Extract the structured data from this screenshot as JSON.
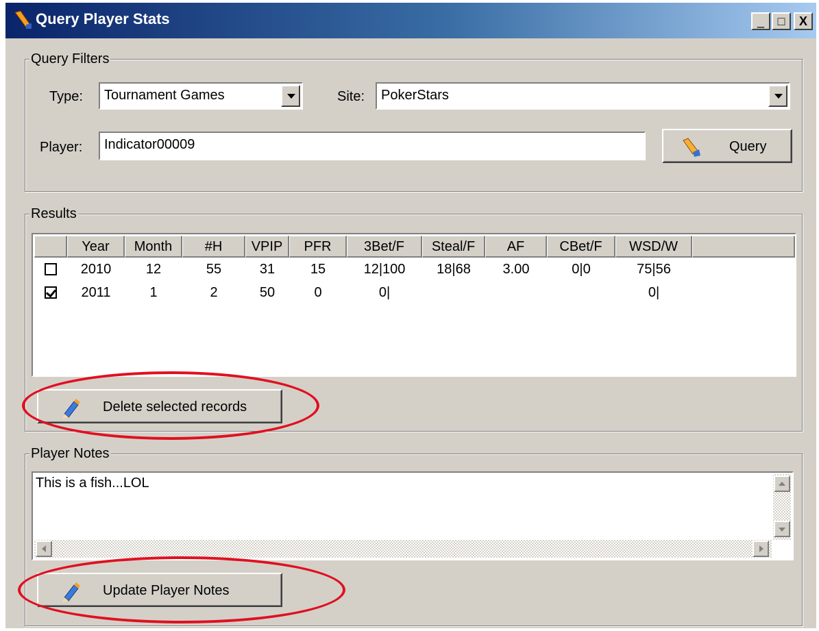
{
  "window": {
    "title": "Query Player Stats",
    "controls": [
      "_",
      "□",
      "X"
    ]
  },
  "filters": {
    "legend": "Query Filters",
    "type_label": "Type:",
    "type_value": "Tournament Games",
    "site_label": "Site:",
    "site_value": "PokerStars",
    "player_label": "Player:",
    "player_value": "Indicator00009",
    "query_button": "Query"
  },
  "results": {
    "legend": "Results",
    "columns": [
      "",
      "Year",
      "Month",
      "#H",
      "VPIP",
      "PFR",
      "3Bet/F",
      "Steal/F",
      "AF",
      "CBet/F",
      "WSD/W"
    ],
    "rows": [
      {
        "checked": false,
        "cells": [
          "2010",
          "12",
          "55",
          "31",
          "15",
          "12|100",
          "18|68",
          "3.00",
          "0|0",
          "75|56"
        ]
      },
      {
        "checked": true,
        "cells": [
          "2011",
          "1",
          "2",
          "50",
          "0",
          "0|",
          "",
          "",
          "",
          "0|"
        ]
      }
    ],
    "delete_button": "Delete selected records"
  },
  "notes": {
    "legend": "Player Notes",
    "text": "This is a fish...LOL",
    "update_button": "Update Player Notes"
  },
  "colors": {
    "annotation": "#e01020",
    "titlebar_start": "#0a246a",
    "titlebar_end": "#a6caf0",
    "window_bg": "#d4d0c8"
  },
  "icons": [
    "flashlight-icon",
    "pencil-icon"
  ]
}
